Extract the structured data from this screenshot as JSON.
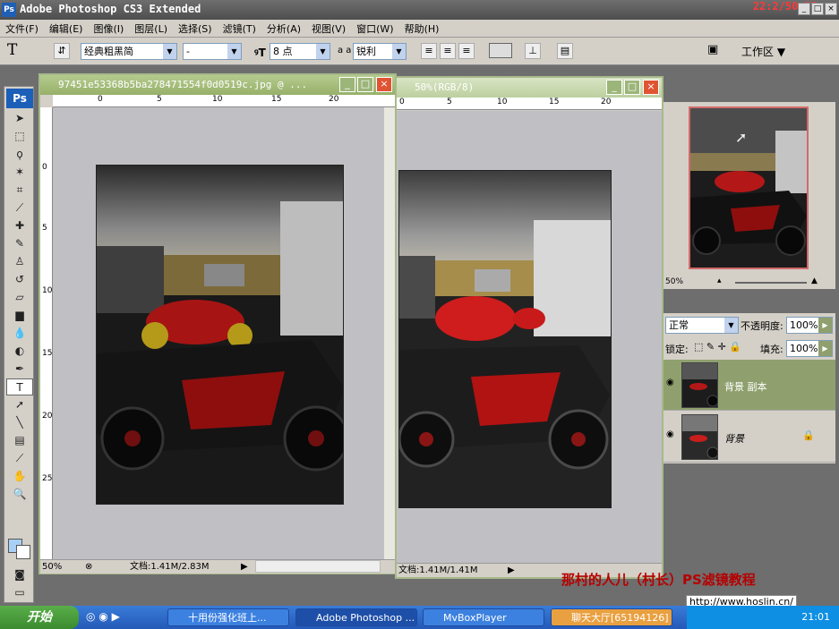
{
  "app": {
    "title": "Adobe Photoshop CS3 Extended",
    "clock": "22:2/50:22",
    "win_min": "_",
    "win_max": "□",
    "win_close": "×"
  },
  "menu": [
    "文件(F)",
    "编辑(E)",
    "图像(I)",
    "图层(L)",
    "选择(S)",
    "滤镜(T)",
    "分析(A)",
    "视图(V)",
    "窗口(W)",
    "帮助(H)"
  ],
  "options": {
    "tool_glyph": "T",
    "font_family": "经典粗黑简",
    "font_style": "-",
    "font_size": "8 点",
    "aa_label": "a a",
    "anti_alias": "锐利",
    "workspace": "工作区 ▼"
  },
  "doc1": {
    "title": "97451e53368b5ba278471554f0d0519c.jpg @ ...",
    "zoom": "50%",
    "status": "文档:1.41M/2.83M",
    "ruler_h": [
      "0",
      "5",
      "10",
      "15",
      "20"
    ],
    "ruler_v": [
      "0",
      "5",
      "10",
      "15",
      "20",
      "25"
    ]
  },
  "doc2": {
    "title": "50%(RGB/8)",
    "status": "文档:1.41M/1.41M",
    "ruler_h": [
      "0",
      "5",
      "10",
      "15",
      "20"
    ]
  },
  "navigator": {
    "zoom": "50%"
  },
  "layers": {
    "blend_mode": "正常",
    "opacity_label": "不透明度:",
    "opacity": "100%",
    "lock_label": "锁定:",
    "fill_label": "填充:",
    "fill": "100%",
    "items": [
      {
        "name": "背景 副本",
        "active": true
      },
      {
        "name": "背景",
        "active": false
      }
    ]
  },
  "watermark": "那村的人儿（村长）PS滤镜教程",
  "url": "http://www.hoslin.cn/",
  "taskbar": {
    "start": "开始",
    "tasks": [
      "十用份强化班上...",
      "Adobe Photoshop ...",
      "MvBoxPlayer",
      "聊天大厅[65194126]"
    ],
    "time": "21:01"
  },
  "colors": {
    "foreground": "#a8cff4",
    "background": "#ffffff",
    "active_layer": "#8fa06e"
  }
}
